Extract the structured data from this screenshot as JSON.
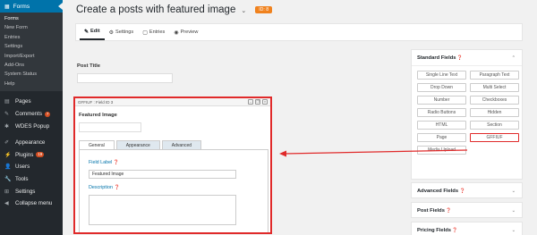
{
  "sidebar": {
    "forms_label": "Forms",
    "forms_sub": [
      "Forms",
      "New Form",
      "Entries",
      "Settings",
      "Import/Export",
      "Add-Ons",
      "System Status",
      "Help"
    ],
    "items": [
      {
        "label": "Pages",
        "icon": "pages-icon",
        "glyph": "▤"
      },
      {
        "label": "Comments",
        "icon": "comments-icon",
        "glyph": "✎",
        "badge": "7"
      },
      {
        "label": "WDES Popup",
        "icon": "pin-icon",
        "glyph": "✱"
      }
    ],
    "items2": [
      {
        "label": "Appearance",
        "icon": "brush-icon",
        "glyph": "✐"
      },
      {
        "label": "Plugins",
        "icon": "plug-icon",
        "glyph": "⚡",
        "badge": "19"
      },
      {
        "label": "Users",
        "icon": "users-icon",
        "glyph": "👤"
      },
      {
        "label": "Tools",
        "icon": "tools-icon",
        "glyph": "🔧"
      },
      {
        "label": "Settings",
        "icon": "settings-icon",
        "glyph": "⊞"
      },
      {
        "label": "Collapse menu",
        "icon": "collapse-icon",
        "glyph": "◀"
      }
    ]
  },
  "header": {
    "title": "Create a posts with featured image",
    "form_id": "ID: 8"
  },
  "toolbar": {
    "tabs": [
      {
        "label": "Edit",
        "glyph": "✎"
      },
      {
        "label": "Settings",
        "glyph": "⚙"
      },
      {
        "label": "Entries",
        "glyph": "▢"
      },
      {
        "label": "Preview",
        "glyph": "◉"
      }
    ]
  },
  "editor": {
    "post_title_label": "Post Title",
    "field_bar": "GFFIUF : Field ID 3",
    "field_label": "Featured Image",
    "tabs": [
      "General",
      "Appearance",
      "Advanced"
    ],
    "field_label_heading": "Field Label",
    "field_label_value": "Featured Image",
    "description_heading": "Description"
  },
  "panels": {
    "standard": "Standard Fields",
    "standard_fields": [
      "Single Line Text",
      "Paragraph Text",
      "Drop Down",
      "Multi Select",
      "Number",
      "Checkboxes",
      "Radio Buttons",
      "Hidden",
      "HTML",
      "Section",
      "Page",
      "GFFIUF",
      "Media Upload"
    ],
    "advanced": "Advanced Fields",
    "post": "Post Fields",
    "pricing": "Pricing Fields"
  },
  "colors": {
    "highlight": "#e02a2a",
    "admin_blue": "#0073aa",
    "sidebar_bg": "#23282d",
    "id_badge": "#f0821e"
  }
}
